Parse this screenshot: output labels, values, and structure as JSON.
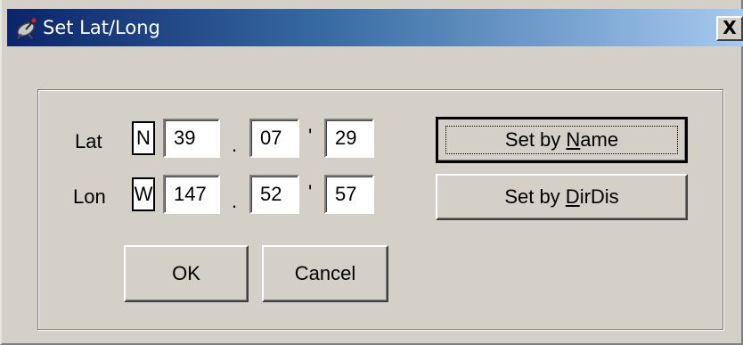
{
  "window": {
    "title": "Set Lat/Long",
    "close_glyph": "X",
    "icon": "satellite-dish-icon"
  },
  "lat": {
    "label": "Lat",
    "dir": "N",
    "deg": "39",
    "sep1": ".",
    "min": "07",
    "sep2": "'",
    "sec": "29"
  },
  "lon": {
    "label": "Lon",
    "dir": "W",
    "deg": "147",
    "sep1": ".",
    "min": "52",
    "sep2": "'",
    "sec": "57"
  },
  "buttons": {
    "ok": "OK",
    "cancel": "Cancel",
    "set_by_name_prefix": "Set by ",
    "set_by_name_accel": "N",
    "set_by_name_rest": "ame",
    "set_by_dirdis_prefix": "Set by ",
    "set_by_dirdis_accel": "D",
    "set_by_dirdis_rest": "irDis"
  },
  "colors": {
    "face": "#d4d0c8",
    "title_start": "#0a246a",
    "title_end": "#a6caf0"
  }
}
